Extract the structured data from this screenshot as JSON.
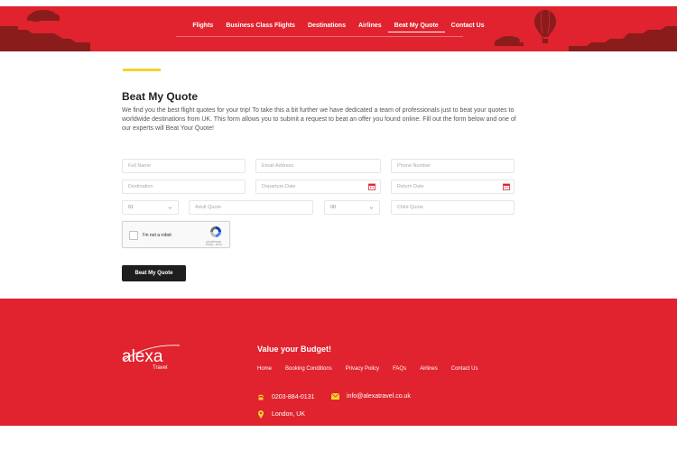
{
  "nav": {
    "items": [
      {
        "label": "Flights"
      },
      {
        "label": "Business Class Flights"
      },
      {
        "label": "Destinations"
      },
      {
        "label": "Airlines"
      },
      {
        "label": "Beat My Quote",
        "active": true
      },
      {
        "label": "Contact Us"
      }
    ]
  },
  "page": {
    "title": "Beat My Quote",
    "intro": "We find you the best flight quotes for your trip! To take this a bit further we have dedicated a team of professionals just to beat your quotes to worldwide destinations from UK. This form allows you to submit a request to beat an offer you found online. Fill out the form below and one of our experts will Beat Your Quote!"
  },
  "form": {
    "full_name_placeholder": "Full Name",
    "email_placeholder": "Email Address",
    "phone_placeholder": "Phone Number",
    "destination_placeholder": "Destination",
    "departure_placeholder": "Departure Date",
    "return_placeholder": "Return Date",
    "adults_count": "01",
    "adult_quote_placeholder": "Adult Quote",
    "children_count": "00",
    "child_quote_placeholder": "Child Quote",
    "captcha_label": "I'm not a robot",
    "captcha_brand": "reCAPTCHA",
    "captcha_terms": "Privacy - Terms",
    "submit_label": "Beat My Quote"
  },
  "footer": {
    "logo_text": "alexa",
    "logo_sub": "Travel",
    "heading": "Value your Budget!",
    "links": [
      "Home",
      "Booking Conditions",
      "Privacy Policy",
      "FAQs",
      "Airlines",
      "Contact Us"
    ],
    "phone": "0203-884-0131",
    "email": "info@alexatravel.co.uk",
    "location": "London, UK"
  },
  "colors": {
    "brand_red": "#e0232e",
    "accent_yellow": "#f2d22e",
    "button_dark": "#1e1e1e"
  }
}
